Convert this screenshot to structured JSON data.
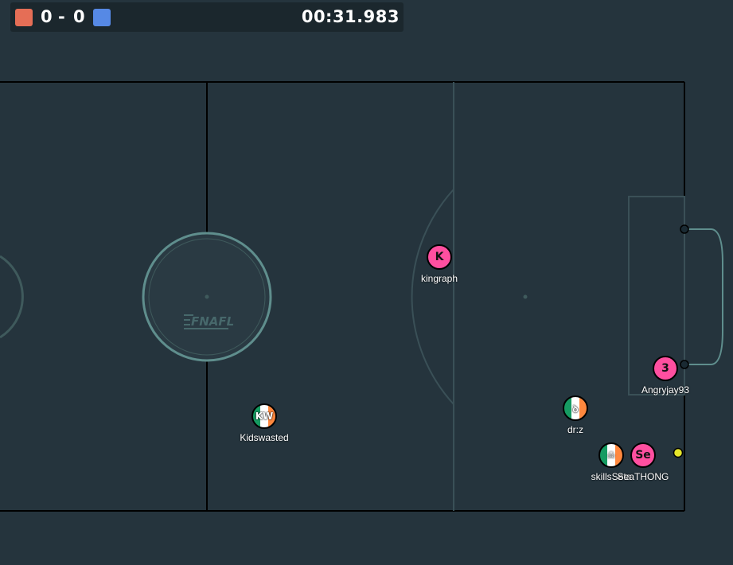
{
  "scoreboard": {
    "red_score": "0",
    "separator": "-",
    "blue_score": "0",
    "timer": "00:31.983",
    "red_color": "#e56e56",
    "blue_color": "#5689e5"
  },
  "field": {
    "logo": "FNAFL",
    "background": "#25343d",
    "line_color": "#000000",
    "circle_color": "#5f8e8d"
  },
  "players": [
    {
      "id": "kingraph",
      "name": "kingraph",
      "avatar": "K",
      "team": "red"
    },
    {
      "id": "angryjay93",
      "name": "Angryjay93",
      "avatar": "3",
      "team": "red"
    },
    {
      "id": "kidswasted",
      "name": "Kidswasted",
      "avatar": "KW",
      "team": "blue"
    },
    {
      "id": "drz",
      "name": "dr:z",
      "avatar": "ꝺ",
      "team": "blue"
    },
    {
      "id": "skills",
      "name": "skillsSeta",
      "avatar": "☠",
      "team": "blue"
    },
    {
      "id": "seathong",
      "name": "SeaTHONG",
      "avatar": "Se",
      "team": "red"
    }
  ],
  "ball": {
    "color": "#e6e62a"
  }
}
